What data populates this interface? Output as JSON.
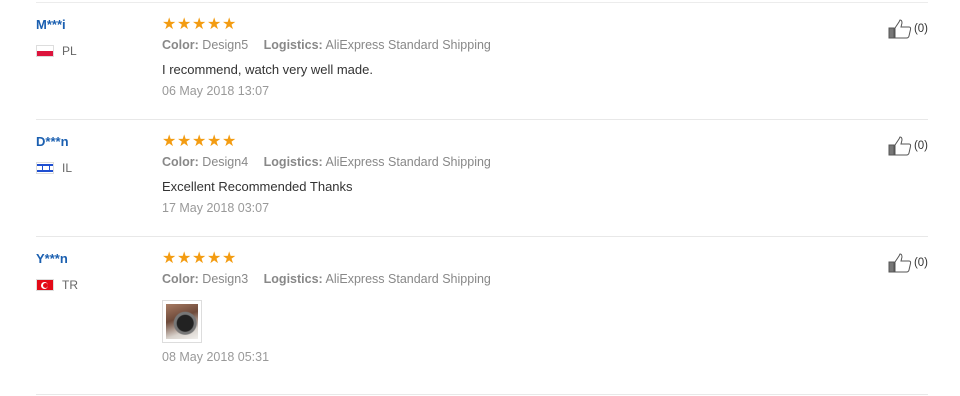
{
  "reviews": [
    {
      "user": "M***i",
      "country": "PL",
      "flag": "poland-flag-icon",
      "rating": 5,
      "color_label": "Color:",
      "color_value": "Design5",
      "logistics_label": "Logistics:",
      "logistics_value": "AliExpress Standard Shipping",
      "text": "I recommend, watch very well made.",
      "date": "06 May 2018 13:07",
      "helpful": "(0)"
    },
    {
      "user": "D***n",
      "country": "IL",
      "flag": "israel-flag-icon",
      "rating": 5,
      "color_label": "Color:",
      "color_value": "Design4",
      "logistics_label": "Logistics:",
      "logistics_value": "AliExpress Standard Shipping",
      "text": "Excellent Recommended Thanks",
      "date": "17 May 2018 03:07",
      "helpful": "(0)"
    },
    {
      "user": "Y***n",
      "country": "TR",
      "flag": "turkey-flag-icon",
      "rating": 5,
      "color_label": "Color:",
      "color_value": "Design3",
      "logistics_label": "Logistics:",
      "logistics_value": "AliExpress Standard Shipping",
      "photo": "watch-photo-thumbnail",
      "date": "08 May 2018 05:31",
      "helpful": "(0)"
    }
  ],
  "colors": {
    "username": "#1a5fb0",
    "star": "#f39c12",
    "meta": "#888888",
    "border": "#e8e8e8"
  },
  "icons": {
    "rating": "star-icon",
    "helpful": "thumbs-up-icon"
  }
}
